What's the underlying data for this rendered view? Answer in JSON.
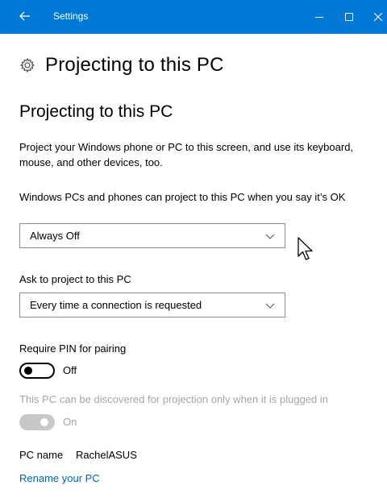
{
  "window": {
    "title": "Settings",
    "accent_color": "#0078d7"
  },
  "icons": {
    "back": "back-arrow-icon",
    "minimize": "minimize-icon",
    "maximize": "maximize-icon",
    "close": "close-icon",
    "header": "gear-icon",
    "dropdown": "chevron-down-icon",
    "cursor": "mouse-pointer-icon"
  },
  "header": {
    "title": "Projecting to this PC"
  },
  "section": {
    "title": "Projecting to this PC",
    "description": "Project your Windows phone or PC to this screen, and use its keyboard, mouse, and other devices, too."
  },
  "projection_setting": {
    "label": "Windows PCs and phones can project to this PC when you say it’s OK",
    "selected": "Always Off"
  },
  "ask_setting": {
    "label": "Ask to project to this PC",
    "selected": "Every time a connection is requested"
  },
  "pin_setting": {
    "label": "Require PIN for pairing",
    "state": "Off"
  },
  "plugged_in_setting": {
    "label": "This PC can be discovered for projection only when it is plugged in",
    "state": "On",
    "disabled": true
  },
  "pc_name": {
    "label": "PC name",
    "value": "RachelASUS"
  },
  "rename_link": {
    "label": "Rename your PC",
    "color": "#0063b1"
  }
}
